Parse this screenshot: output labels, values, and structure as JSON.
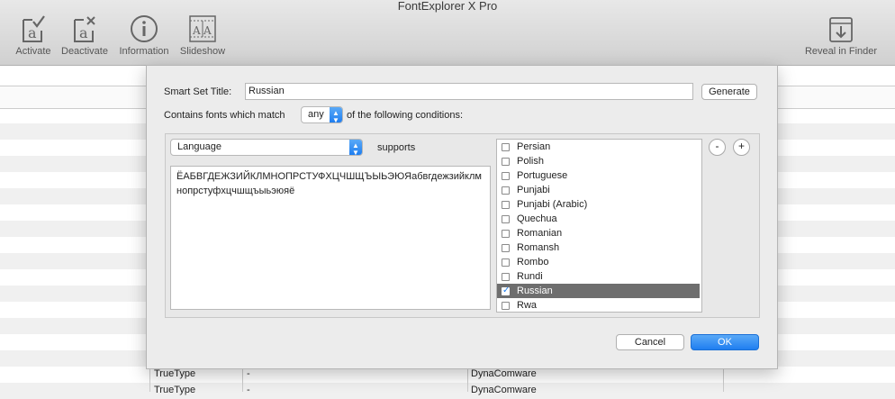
{
  "window": {
    "title": "FontExplorer X Pro"
  },
  "toolbar": {
    "activate": "Activate",
    "deactivate": "Deactivate",
    "information": "Information",
    "slideshow": "Slideshow",
    "reveal": "Reveal in Finder"
  },
  "background_rows": [
    {
      "type": "TrueType",
      "col2": "-",
      "foundry": "DynaComware"
    },
    {
      "type": "TrueType",
      "col2": "-",
      "foundry": "DynaComware"
    }
  ],
  "dialog": {
    "smart_set_title_label": "Smart Set Title:",
    "smart_set_title_value": "Russian",
    "generate_label": "Generate",
    "contains_label": "Contains fonts which match",
    "match_value": "any",
    "conditions_label": "of the following conditions:",
    "criterion": "Language",
    "operator": "supports",
    "sample_text": "ЁАБВГДЕЖЗИЙКЛМНОПРСТУФХЦЧШЩЪЫЬЭЮЯабвгдежзийклмнопрстуфхцчшщъыьэюяё",
    "remove_label": "-",
    "add_label": "+",
    "languages": [
      {
        "name": "Persian",
        "checked": false
      },
      {
        "name": "Polish",
        "checked": false
      },
      {
        "name": "Portuguese",
        "checked": false
      },
      {
        "name": "Punjabi",
        "checked": false
      },
      {
        "name": "Punjabi (Arabic)",
        "checked": false
      },
      {
        "name": "Quechua",
        "checked": false
      },
      {
        "name": "Romanian",
        "checked": false
      },
      {
        "name": "Romansh",
        "checked": false
      },
      {
        "name": "Rombo",
        "checked": false
      },
      {
        "name": "Rundi",
        "checked": false
      },
      {
        "name": "Russian",
        "checked": true,
        "selected": true
      },
      {
        "name": "Rwa",
        "checked": false
      }
    ],
    "cancel_label": "Cancel",
    "ok_label": "OK"
  }
}
